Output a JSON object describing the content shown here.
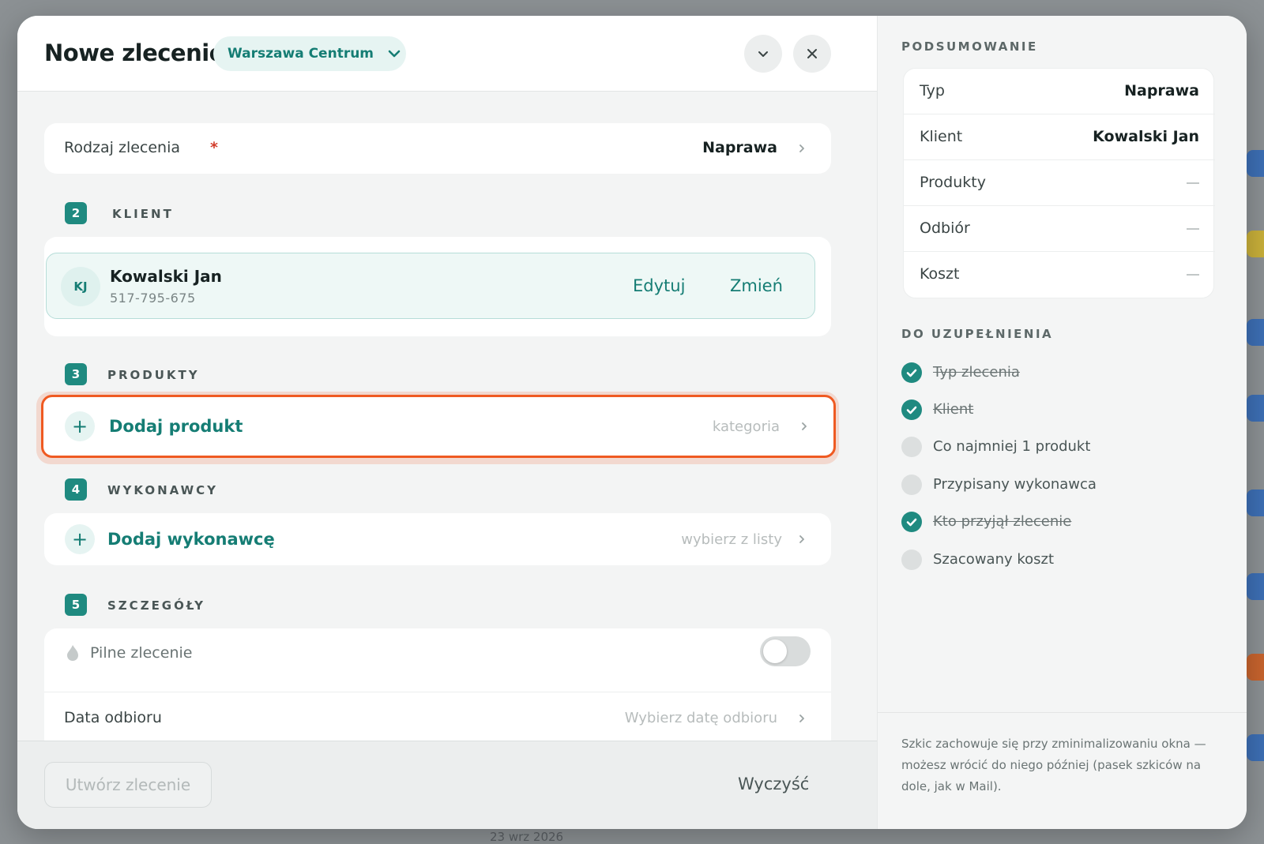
{
  "header": {
    "title": "Nowe zlecenie",
    "branch": "Warszawa Centrum"
  },
  "order_type": {
    "label": "Rodzaj zlecenia",
    "required_mark": "*",
    "value": "Naprawa"
  },
  "sections": {
    "client": {
      "number": "2",
      "title": "KLIENT"
    },
    "products": {
      "number": "3",
      "title": "PRODUKTY"
    },
    "contractors": {
      "number": "4",
      "title": "WYKONAWCY"
    },
    "details": {
      "number": "5",
      "title": "SZCZEGÓŁY"
    }
  },
  "client": {
    "initials": "KJ",
    "name": "Kowalski Jan",
    "phone": "517-795-675",
    "edit_label": "Edytuj",
    "change_label": "Zmień"
  },
  "products": {
    "add_label": "Dodaj produkt",
    "hint": "kategoria"
  },
  "contractors": {
    "add_label": "Dodaj wykonawcę",
    "hint": "wybierz z listy"
  },
  "details": {
    "urgent_label": "Pilne zlecenie",
    "urgent_on": false,
    "pickup_label": "Data odbioru",
    "pickup_placeholder": "Wybierz datę odbioru"
  },
  "footer": {
    "create_label": "Utwórz zlecenie",
    "clear_label": "Wyczyść"
  },
  "summary": {
    "heading": "PODSUMOWANIE",
    "rows": [
      {
        "label": "Typ",
        "value": "Naprawa"
      },
      {
        "label": "Klient",
        "value": "Kowalski Jan"
      },
      {
        "label": "Produkty",
        "value": ""
      },
      {
        "label": "Odbiór",
        "value": ""
      },
      {
        "label": "Koszt",
        "value": ""
      }
    ]
  },
  "checklist": {
    "heading": "DO UZUPEŁNIENIA",
    "items": [
      {
        "label": "Typ zlecenia",
        "done": true
      },
      {
        "label": "Klient",
        "done": true
      },
      {
        "label": "Co najmniej 1 produkt",
        "done": false
      },
      {
        "label": "Przypisany wykonawca",
        "done": false
      },
      {
        "label": "Kto przyjął zlecenie",
        "done": true
      },
      {
        "label": "Szacowany koszt",
        "done": false
      }
    ]
  },
  "note": "Szkic zachowuje się przy zminimalizowaniu okna — możesz wrócić do niego później (pasek szkiców na dole, jak w Mail).",
  "background": {
    "bottom_text": "23 wrz 2026"
  },
  "colors": {
    "accent": "#1f8a80",
    "focus": "#ef5a22"
  }
}
